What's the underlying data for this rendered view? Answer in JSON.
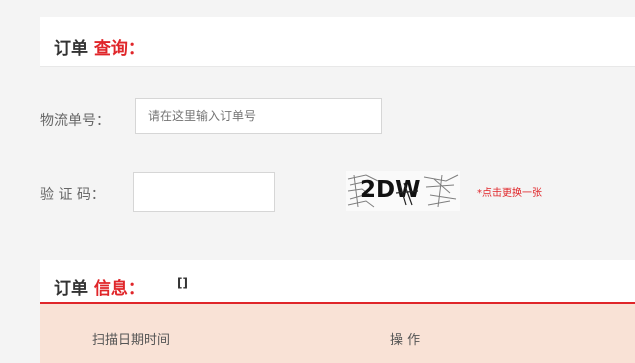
{
  "query_header": {
    "prefix": "订单",
    "accent": "查询："
  },
  "tracking": {
    "label": "物流单号：",
    "placeholder": "请在这里输入订单号"
  },
  "captcha": {
    "label": "验 证 码：",
    "image_text": "2DW",
    "refresh_text": "*点击更换一张"
  },
  "info_header": {
    "prefix": "订单",
    "accent": "信息：",
    "brackets": "[]"
  },
  "table": {
    "columns": [
      "扫描日期时间",
      "操 作"
    ]
  },
  "colors": {
    "accent": "#e0262a",
    "table_header_bg": "#f9e2d6",
    "page_bg": "#f4f4f4"
  }
}
